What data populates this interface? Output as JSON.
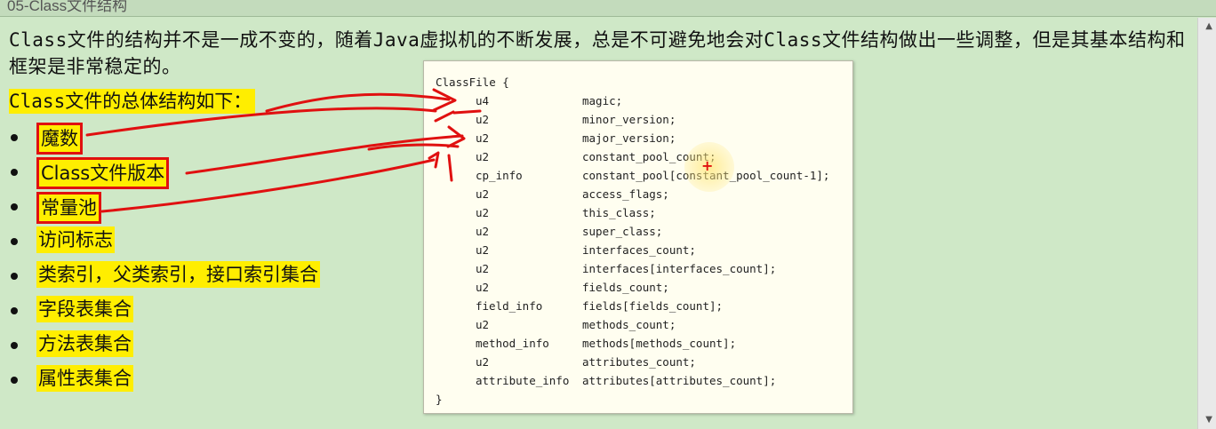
{
  "window": {
    "title": "05-Class文件结构"
  },
  "intro": {
    "part1": "Class",
    "part2": "文件的结构并不是一成不变的，随着",
    "part3": "Java",
    "part4": "虚拟机的不断发展，总是不可避免地会对",
    "part5": "Class",
    "part6": "文件结构做出一些调整，但是其基本结构和框架是非常稳定的。"
  },
  "subheading": {
    "mono": "Class",
    "text": "文件的总体结构如下："
  },
  "list": [
    {
      "label": "魔数",
      "boxed": true
    },
    {
      "label": "Class文件版本",
      "boxed": true
    },
    {
      "label": "常量池",
      "boxed": true
    },
    {
      "label": "访问标志",
      "boxed": false
    },
    {
      "label": "类索引，父类索引，接口索引集合",
      "boxed": false
    },
    {
      "label": "字段表集合",
      "boxed": false
    },
    {
      "label": "方法表集合",
      "boxed": false
    },
    {
      "label": "属性表集合",
      "boxed": false
    }
  ],
  "code": {
    "header": "ClassFile {",
    "footer": "}",
    "rows": [
      {
        "type": "u4",
        "field": "magic;"
      },
      {
        "type": "u2",
        "field": "minor_version;"
      },
      {
        "type": "u2",
        "field": "major_version;"
      },
      {
        "type": "u2",
        "field": "constant_pool_count;"
      },
      {
        "type": "cp_info",
        "field": "constant_pool[constant_pool_count-1];"
      },
      {
        "type": "u2",
        "field": "access_flags;"
      },
      {
        "type": "u2",
        "field": "this_class;"
      },
      {
        "type": "u2",
        "field": "super_class;"
      },
      {
        "type": "u2",
        "field": "interfaces_count;"
      },
      {
        "type": "u2",
        "field": "interfaces[interfaces_count];"
      },
      {
        "type": "u2",
        "field": "fields_count;"
      },
      {
        "type": "field_info",
        "field": "fields[fields_count];"
      },
      {
        "type": "u2",
        "field": "methods_count;"
      },
      {
        "type": "method_info",
        "field": "methods[methods_count];"
      },
      {
        "type": "u2",
        "field": "attributes_count;"
      },
      {
        "type": "attribute_info",
        "field": "attributes[attributes_count];"
      }
    ]
  },
  "colors": {
    "background": "#cfe8c7",
    "highlight": "#ffee00",
    "annotation": "#e01010",
    "code_bg": "#fffef0"
  }
}
